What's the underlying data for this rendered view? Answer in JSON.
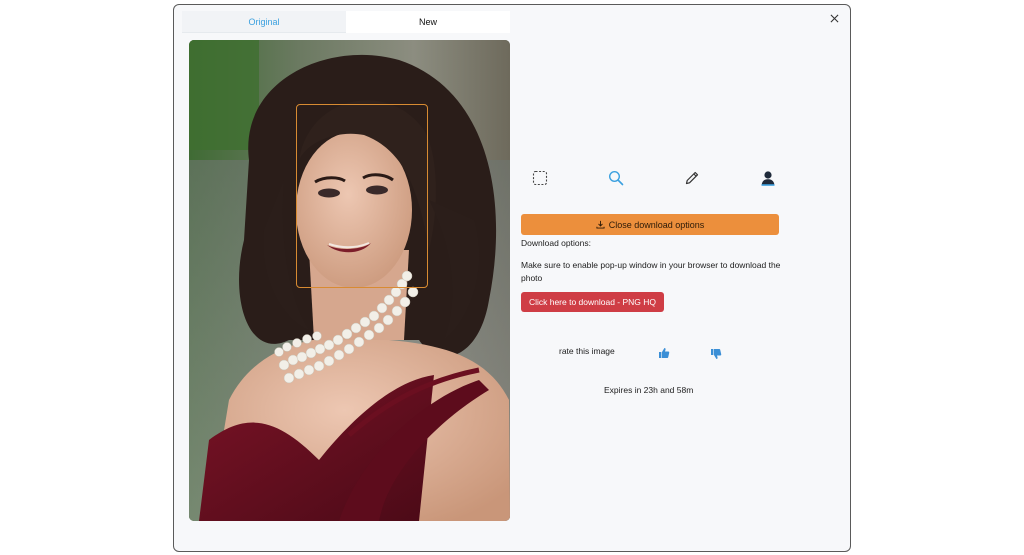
{
  "tabs": {
    "original_label": "Original",
    "new_label": "New"
  },
  "toolbar": {
    "icons": [
      "select-rectangle-icon",
      "magnifier-icon",
      "pencil-icon",
      "person-icon"
    ]
  },
  "download": {
    "toggle_label": "Close download options",
    "options_heading": "Download options:",
    "popup_note": "Make sure to enable pop-up window in your browser to download the photo",
    "link_label": "Click here to download - PNG HQ"
  },
  "rating": {
    "label": "rate this image"
  },
  "expiry": {
    "text": "Expires in 23h and 58m"
  },
  "colors": {
    "accent_blue": "#3ba0df",
    "download_orange": "#ec8f3c",
    "download_red": "#cf3d45",
    "face_box": "#d88b32"
  }
}
